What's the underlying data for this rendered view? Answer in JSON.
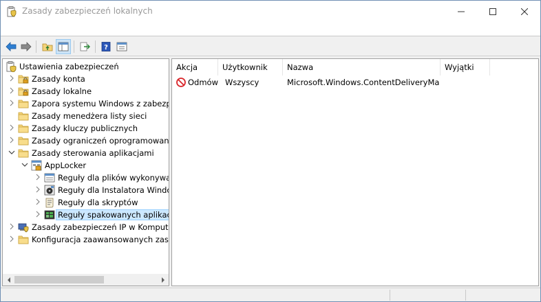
{
  "window": {
    "title": "Zasady zabezpieczeń lokalnych"
  },
  "window_controls": {
    "minimize_icon": "minimize-icon",
    "maximize_icon": "maximize-icon",
    "close_icon": "close-icon"
  },
  "toolbar": {
    "items": [
      "back-arrow-icon",
      "forward-arrow-icon",
      "up-folder-icon",
      "show-hide-tree-icon",
      "export-list-icon",
      "help-icon",
      "properties-icon"
    ]
  },
  "tree": {
    "items": [
      {
        "label": "Ustawienia zabezpieczeń",
        "icon": "security-settings-icon",
        "level": 0
      },
      {
        "label": "Zasady konta",
        "icon": "folder-lock-icon",
        "level": 1,
        "expander": "collapsed"
      },
      {
        "label": "Zasady lokalne",
        "icon": "folder-lock-icon",
        "level": 1,
        "expander": "collapsed"
      },
      {
        "label": "Zapora systemu Windows z zabezpiec",
        "icon": "folder-icon",
        "level": 1,
        "expander": "collapsed"
      },
      {
        "label": "Zasady menedżera listy sieci",
        "icon": "folder-icon",
        "level": 1,
        "expander": "none"
      },
      {
        "label": "Zasady kluczy publicznych",
        "icon": "folder-icon",
        "level": 1,
        "expander": "collapsed"
      },
      {
        "label": "Zasady ograniczeń oprogramowania",
        "icon": "folder-icon",
        "level": 1,
        "expander": "collapsed"
      },
      {
        "label": "Zasady sterowania aplikacjami",
        "icon": "folder-icon",
        "level": 1,
        "expander": "expanded"
      },
      {
        "label": "AppLocker",
        "icon": "applocker-icon",
        "level": 2,
        "expander": "expanded"
      },
      {
        "label": "Reguły dla plików wykonywalr",
        "icon": "executable-rules-icon",
        "level": 3,
        "expander": "collapsed"
      },
      {
        "label": "Reguły dla Instalatora Window",
        "icon": "installer-rules-icon",
        "level": 3,
        "expander": "collapsed"
      },
      {
        "label": "Reguły dla skryptów",
        "icon": "script-rules-icon",
        "level": 3,
        "expander": "collapsed"
      },
      {
        "label": "Reguły spakowanych aplikacji",
        "icon": "packaged-app-rules-icon",
        "level": 3,
        "expander": "collapsed",
        "selected": true
      },
      {
        "label": "Zasady zabezpieczeń IP w Komputer l",
        "icon": "ip-security-icon",
        "level": 1,
        "expander": "collapsed"
      },
      {
        "label": "Konfiguracja zaawansowanych zasad",
        "icon": "folder-icon",
        "level": 1,
        "expander": "collapsed"
      }
    ]
  },
  "list": {
    "columns": [
      "Akcja",
      "Użytkownik",
      "Nazwa",
      "Wyjątki"
    ],
    "rows": [
      {
        "action": "Odmów",
        "action_icon": "deny-icon",
        "user": "Wszyscy",
        "name": "Microsoft.Windows.ContentDeliveryMa...",
        "exceptions": ""
      }
    ]
  },
  "colors": {
    "selection_bg": "#cce8ff",
    "selection_border": "#99d1ff",
    "deny_red": "#d9262b",
    "folder_yellow": "#f3d37a"
  }
}
